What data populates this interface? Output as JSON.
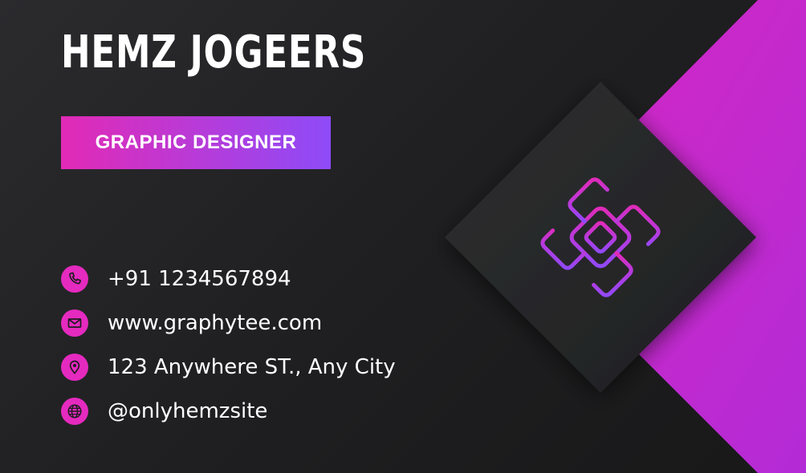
{
  "card": {
    "name": "HEMZ JOGEERS",
    "title": "GRAPHIC DESIGNER",
    "contacts": [
      {
        "icon": "phone-icon",
        "text": "+91 1234567894"
      },
      {
        "icon": "mail-icon",
        "text": "www.graphytee.com"
      },
      {
        "icon": "location-pin-icon",
        "text": "123 Anywhere ST., Any City"
      },
      {
        "icon": "globe-icon",
        "text": "@onlyhemzsite"
      }
    ]
  },
  "colors": {
    "background": "#1f1f21",
    "accent_pink": "#e22ab6",
    "accent_purple": "#8e4bf8",
    "icon_bg": "#e52abf",
    "text": "#ffffff"
  }
}
